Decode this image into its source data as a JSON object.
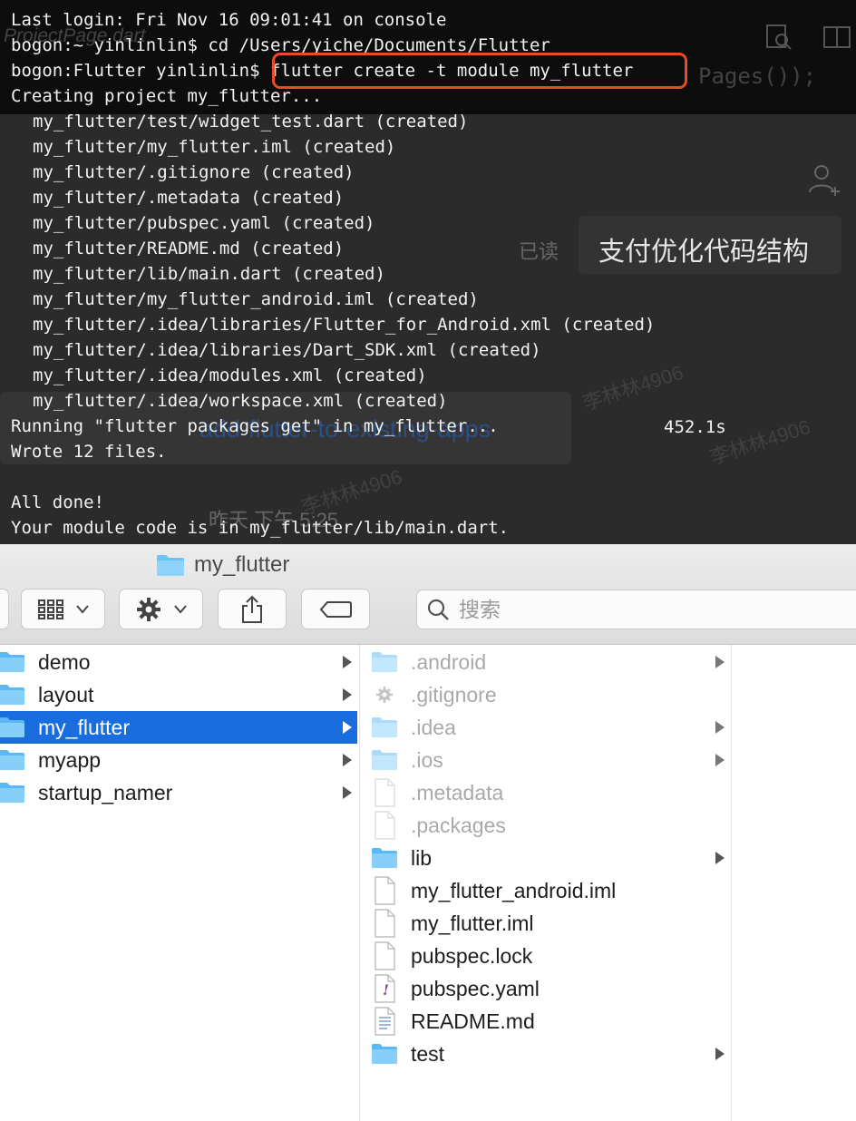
{
  "terminal": {
    "lines": [
      "Last login: Fri Nov 16 09:01:41 on console",
      "bogon:~ yinlinlin$ cd /Users/yiche/Documents/Flutter",
      "bogon:Flutter yinlinlin$ flutter create -t module my_flutter",
      "Creating project my_flutter...",
      "my_flutter/test/widget_test.dart (created)",
      "my_flutter/my_flutter.iml (created)",
      "my_flutter/.gitignore (created)",
      "my_flutter/.metadata (created)",
      "my_flutter/pubspec.yaml (created)",
      "my_flutter/README.md (created)",
      "my_flutter/lib/main.dart (created)",
      "my_flutter/my_flutter_android.iml (created)",
      "my_flutter/.idea/libraries/Flutter_for_Android.xml (created)",
      "my_flutter/.idea/libraries/Dart_SDK.xml (created)",
      "my_flutter/.idea/modules.xml (created)",
      "my_flutter/.idea/workspace.xml (created)",
      "Running \"flutter packages get\" in my_flutter...",
      "Wrote 12 files.",
      "",
      "All done!",
      "Your module code is in my_flutter/lib/main.dart."
    ],
    "elapsed": "452.1s",
    "background": {
      "tab_title": "ProjectPage.dart",
      "code_fragment": "Pages());",
      "read_label": "已读",
      "chat_bubble": "支付优化代码结构",
      "timestamp": "昨天 下午 5:25",
      "watermarks": [
        "李林林4906",
        "李林林4906",
        "李林林4906"
      ],
      "link_fragment": "add-flutter-to-existing-apps"
    }
  },
  "finder": {
    "window_title": "my_flutter",
    "toolbar": {
      "view_icon": "grid-icon",
      "action_icon": "gear-icon",
      "share_icon": "share-icon",
      "tag_icon": "tag-icon",
      "search_placeholder": "搜索"
    },
    "column1": [
      {
        "name": "demo",
        "type": "folder",
        "hasChildren": true,
        "selected": false
      },
      {
        "name": "layout",
        "type": "folder",
        "hasChildren": true,
        "selected": false
      },
      {
        "name": "my_flutter",
        "type": "folder",
        "hasChildren": true,
        "selected": true
      },
      {
        "name": "myapp",
        "type": "folder",
        "hasChildren": true,
        "selected": false
      },
      {
        "name": "startup_namer",
        "type": "folder",
        "hasChildren": true,
        "selected": false
      }
    ],
    "column2": [
      {
        "name": ".android",
        "type": "folder",
        "hasChildren": true,
        "hidden": true
      },
      {
        "name": ".gitignore",
        "type": "config",
        "hasChildren": false,
        "hidden": true
      },
      {
        "name": ".idea",
        "type": "folder",
        "hasChildren": true,
        "hidden": true
      },
      {
        "name": ".ios",
        "type": "folder",
        "hasChildren": true,
        "hidden": true
      },
      {
        "name": ".metadata",
        "type": "file",
        "hasChildren": false,
        "hidden": true
      },
      {
        "name": ".packages",
        "type": "file",
        "hasChildren": false,
        "hidden": true
      },
      {
        "name": "lib",
        "type": "folder",
        "hasChildren": true,
        "hidden": false
      },
      {
        "name": "my_flutter_android.iml",
        "type": "file",
        "hasChildren": false,
        "hidden": false
      },
      {
        "name": "my_flutter.iml",
        "type": "file",
        "hasChildren": false,
        "hidden": false
      },
      {
        "name": "pubspec.lock",
        "type": "file",
        "hasChildren": false,
        "hidden": false
      },
      {
        "name": "pubspec.yaml",
        "type": "yaml",
        "hasChildren": false,
        "hidden": false
      },
      {
        "name": "README.md",
        "type": "text",
        "hasChildren": false,
        "hidden": false
      },
      {
        "name": "test",
        "type": "folder",
        "hasChildren": true,
        "hidden": false
      }
    ]
  },
  "colors": {
    "selection": "#1a6ddf",
    "highlight_box": "#ea4a2a",
    "folder": "#6cc3f7",
    "terminal_bg": "#2b2b2b"
  }
}
